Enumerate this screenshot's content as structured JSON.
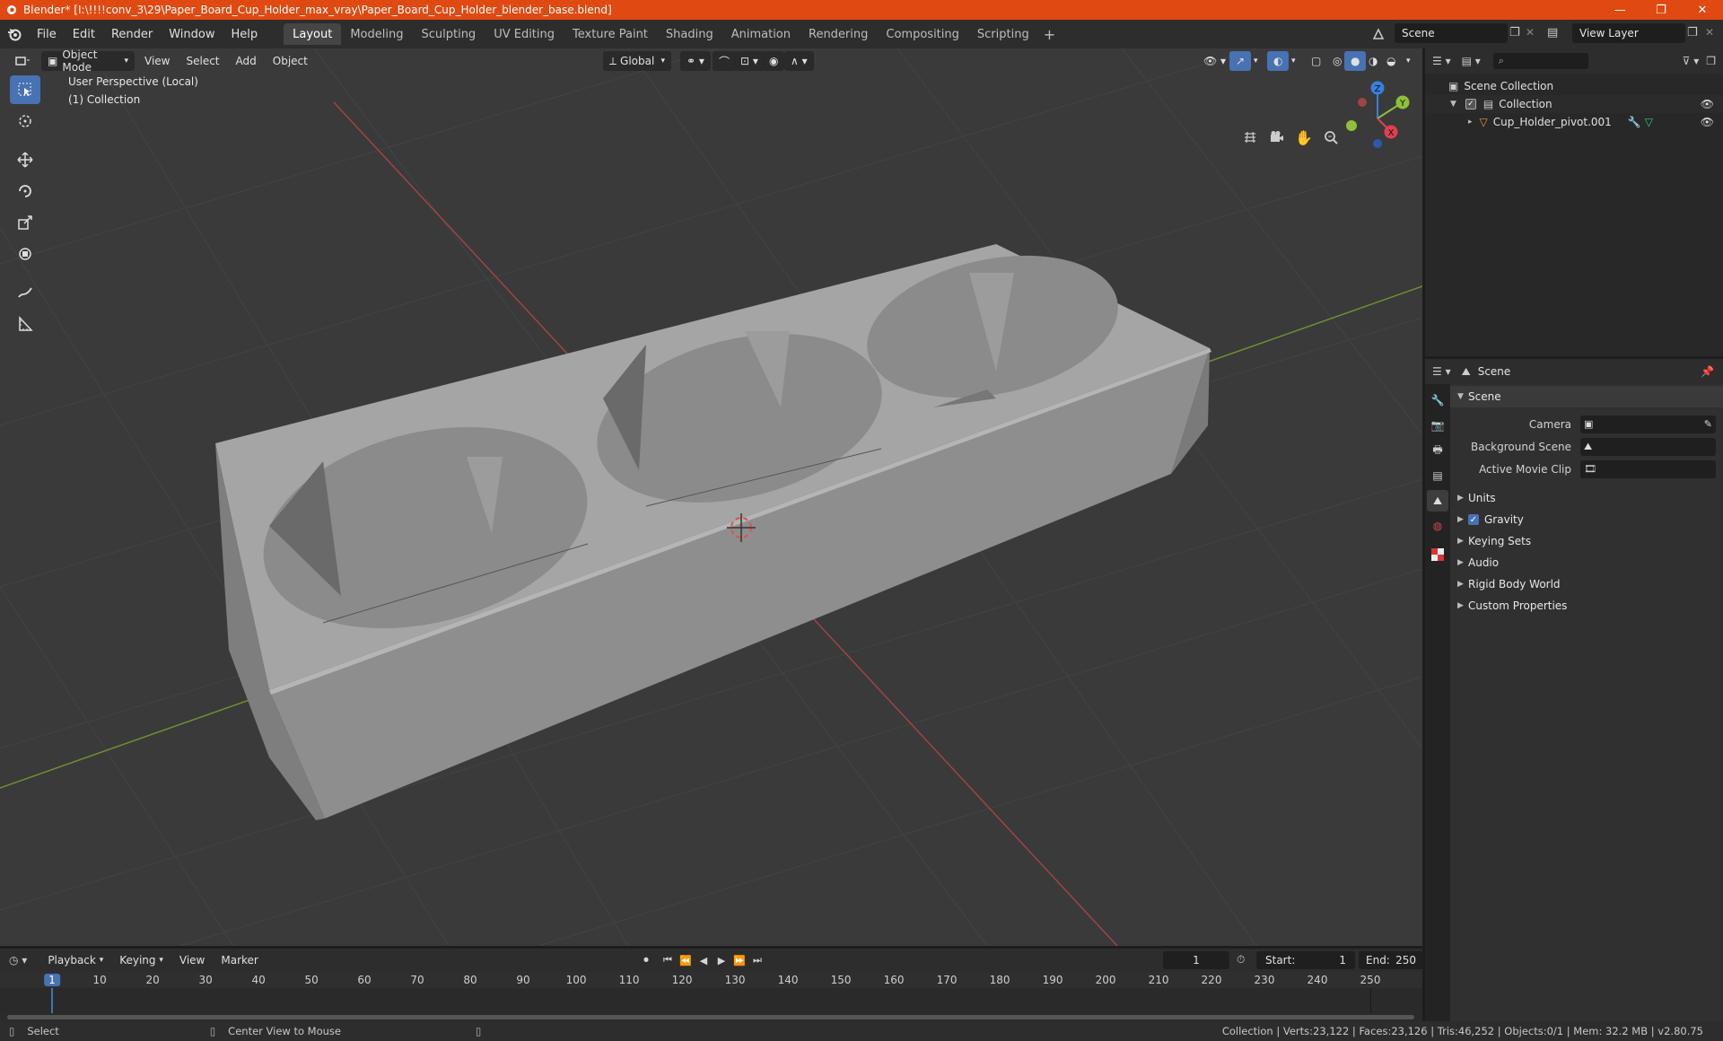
{
  "window": {
    "title": "Blender* [I:\\!!!!conv_3\\29\\Paper_Board_Cup_Holder_max_vray\\Paper_Board_Cup_Holder_blender_base.blend]",
    "minimize": "—",
    "restore": "❐",
    "close": "✕"
  },
  "menus": [
    "File",
    "Edit",
    "Render",
    "Window",
    "Help"
  ],
  "workspaces": [
    "Layout",
    "Modeling",
    "Sculpting",
    "UV Editing",
    "Texture Paint",
    "Shading",
    "Animation",
    "Rendering",
    "Compositing",
    "Scripting"
  ],
  "active_workspace": "Layout",
  "scene_name": "Scene",
  "view_layer": "View Layer",
  "viewport": {
    "mode": "Object Mode",
    "menus": [
      "View",
      "Select",
      "Add",
      "Object"
    ],
    "orientation": "Global",
    "perspective_label": "User Perspective (Local)",
    "collection_label": "(1) Collection",
    "gizmo_axes": {
      "x": "X",
      "y": "Y",
      "z": "Z"
    }
  },
  "outliner": {
    "root": "Scene Collection",
    "collection": "Collection",
    "object": "Cup_Holder_pivot.001"
  },
  "properties": {
    "context": "Scene",
    "panel_title": "Scene",
    "fields": [
      {
        "label": "Camera"
      },
      {
        "label": "Background Scene"
      },
      {
        "label": "Active Movie Clip"
      }
    ],
    "sections": [
      "Units",
      "Gravity",
      "Keying Sets",
      "Audio",
      "Rigid Body World",
      "Custom Properties"
    ]
  },
  "timeline": {
    "menus": [
      "Playback",
      "Keying",
      "View",
      "Marker"
    ],
    "current_frame": "1",
    "start_label": "Start:",
    "start": "1",
    "end_label": "End:",
    "end": "250",
    "ruler": [
      "1",
      "10",
      "20",
      "30",
      "40",
      "50",
      "60",
      "70",
      "80",
      "90",
      "100",
      "110",
      "120",
      "130",
      "140",
      "150",
      "160",
      "170",
      "180",
      "190",
      "200",
      "210",
      "220",
      "230",
      "240",
      "250"
    ]
  },
  "statusbar": {
    "select": "Select",
    "center": "Center View to Mouse",
    "stats": "Collection | Verts:23,122 | Faces:23,126 | Tris:46,252 | Objects:0/1 | Mem: 32.2 MB | v2.80.75"
  },
  "colors": {
    "titlebar": "#e04a12",
    "accent": "#4772b3",
    "x_axis": "#e0404f",
    "y_axis": "#8ec03a",
    "z_axis": "#3a7fe0"
  }
}
